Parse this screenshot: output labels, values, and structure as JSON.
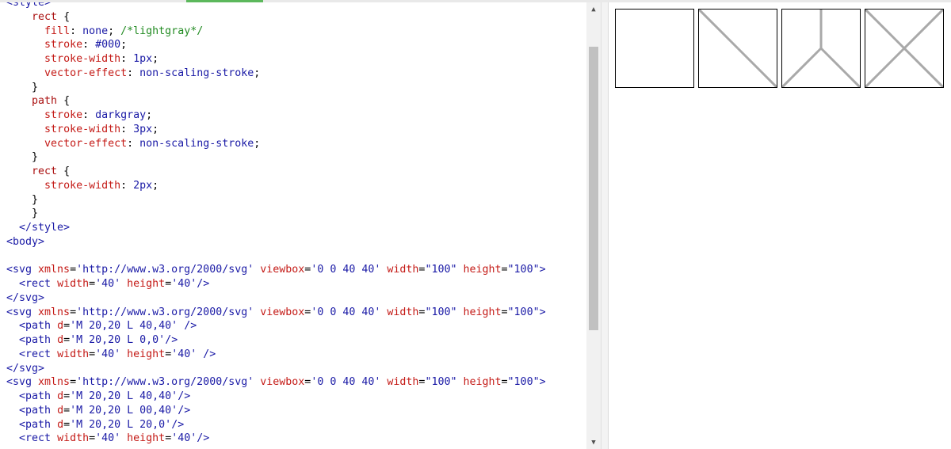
{
  "editor": {
    "lines": [
      {
        "indent": "",
        "tokens": [
          {
            "c": "c-tagb",
            "t": "<style>"
          }
        ]
      },
      {
        "indent": "    ",
        "tokens": [
          {
            "c": "c-sel",
            "t": "rect"
          },
          {
            "c": "c-punct",
            "t": " {"
          }
        ]
      },
      {
        "indent": "      ",
        "tokens": [
          {
            "c": "c-prop",
            "t": "fill"
          },
          {
            "c": "c-punct",
            "t": ": "
          },
          {
            "c": "c-val",
            "t": "none"
          },
          {
            "c": "c-punct",
            "t": "; "
          },
          {
            "c": "c-comment",
            "t": "/*lightgray*/"
          }
        ]
      },
      {
        "indent": "      ",
        "tokens": [
          {
            "c": "c-prop",
            "t": "stroke"
          },
          {
            "c": "c-punct",
            "t": ": "
          },
          {
            "c": "c-val",
            "t": "#000"
          },
          {
            "c": "c-punct",
            "t": ";"
          }
        ]
      },
      {
        "indent": "      ",
        "tokens": [
          {
            "c": "c-prop",
            "t": "stroke-width"
          },
          {
            "c": "c-punct",
            "t": ": "
          },
          {
            "c": "c-val",
            "t": "1px"
          },
          {
            "c": "c-punct",
            "t": ";"
          }
        ]
      },
      {
        "indent": "      ",
        "tokens": [
          {
            "c": "c-prop",
            "t": "vector-effect"
          },
          {
            "c": "c-punct",
            "t": ": "
          },
          {
            "c": "c-val",
            "t": "non-scaling-stroke"
          },
          {
            "c": "c-punct",
            "t": ";"
          }
        ]
      },
      {
        "indent": "    ",
        "tokens": [
          {
            "c": "c-punct",
            "t": "}"
          }
        ]
      },
      {
        "indent": "    ",
        "tokens": [
          {
            "c": "c-sel",
            "t": "path"
          },
          {
            "c": "c-punct",
            "t": " {"
          }
        ]
      },
      {
        "indent": "      ",
        "tokens": [
          {
            "c": "c-prop",
            "t": "stroke"
          },
          {
            "c": "c-punct",
            "t": ": "
          },
          {
            "c": "c-val",
            "t": "darkgray"
          },
          {
            "c": "c-punct",
            "t": ";"
          }
        ]
      },
      {
        "indent": "      ",
        "tokens": [
          {
            "c": "c-prop",
            "t": "stroke-width"
          },
          {
            "c": "c-punct",
            "t": ": "
          },
          {
            "c": "c-val",
            "t": "3px"
          },
          {
            "c": "c-punct",
            "t": ";"
          }
        ]
      },
      {
        "indent": "      ",
        "tokens": [
          {
            "c": "c-prop",
            "t": "vector-effect"
          },
          {
            "c": "c-punct",
            "t": ": "
          },
          {
            "c": "c-val",
            "t": "non-scaling-stroke"
          },
          {
            "c": "c-punct",
            "t": ";"
          }
        ]
      },
      {
        "indent": "    ",
        "tokens": [
          {
            "c": "c-punct",
            "t": "}"
          }
        ]
      },
      {
        "indent": "    ",
        "tokens": [
          {
            "c": "c-sel",
            "t": "rect"
          },
          {
            "c": "c-punct",
            "t": " {"
          }
        ]
      },
      {
        "indent": "      ",
        "tokens": [
          {
            "c": "c-prop",
            "t": "stroke-width"
          },
          {
            "c": "c-punct",
            "t": ": "
          },
          {
            "c": "c-val",
            "t": "2px"
          },
          {
            "c": "c-punct",
            "t": ";"
          }
        ]
      },
      {
        "indent": "    ",
        "tokens": [
          {
            "c": "c-punct",
            "t": "}"
          }
        ]
      },
      {
        "indent": "    ",
        "tokens": [
          {
            "c": "c-punct",
            "t": "}"
          }
        ]
      },
      {
        "indent": "  ",
        "tokens": [
          {
            "c": "c-tagb",
            "t": "</style>"
          }
        ]
      },
      {
        "indent": "",
        "tokens": [
          {
            "c": "c-tagb",
            "t": "<body>"
          }
        ]
      },
      {
        "indent": "",
        "tokens": []
      },
      {
        "indent": "",
        "tokens": [
          {
            "c": "c-tagb",
            "t": "<svg "
          },
          {
            "c": "c-prop",
            "t": "xmlns"
          },
          {
            "c": "c-punct",
            "t": "="
          },
          {
            "c": "c-val",
            "t": "'http://www.w3.org/2000/svg'"
          },
          {
            "c": "c-punct",
            "t": " "
          },
          {
            "c": "c-prop",
            "t": "viewbox"
          },
          {
            "c": "c-punct",
            "t": "="
          },
          {
            "c": "c-val",
            "t": "'0 0 40 40'"
          },
          {
            "c": "c-punct",
            "t": " "
          },
          {
            "c": "c-prop",
            "t": "width"
          },
          {
            "c": "c-punct",
            "t": "="
          },
          {
            "c": "c-val",
            "t": "\"100\""
          },
          {
            "c": "c-punct",
            "t": " "
          },
          {
            "c": "c-prop",
            "t": "height"
          },
          {
            "c": "c-punct",
            "t": "="
          },
          {
            "c": "c-val",
            "t": "\"100\""
          },
          {
            "c": "c-tagb",
            "t": ">"
          }
        ]
      },
      {
        "indent": "  ",
        "tokens": [
          {
            "c": "c-tagb",
            "t": "<rect "
          },
          {
            "c": "c-prop",
            "t": "width"
          },
          {
            "c": "c-punct",
            "t": "="
          },
          {
            "c": "c-val",
            "t": "'40'"
          },
          {
            "c": "c-punct",
            "t": " "
          },
          {
            "c": "c-prop",
            "t": "height"
          },
          {
            "c": "c-punct",
            "t": "="
          },
          {
            "c": "c-val",
            "t": "'40'"
          },
          {
            "c": "c-tagb",
            "t": "/>"
          }
        ]
      },
      {
        "indent": "",
        "tokens": [
          {
            "c": "c-tagb",
            "t": "</svg>"
          }
        ]
      },
      {
        "indent": "",
        "tokens": [
          {
            "c": "c-tagb",
            "t": "<svg "
          },
          {
            "c": "c-prop",
            "t": "xmlns"
          },
          {
            "c": "c-punct",
            "t": "="
          },
          {
            "c": "c-val",
            "t": "'http://www.w3.org/2000/svg'"
          },
          {
            "c": "c-punct",
            "t": " "
          },
          {
            "c": "c-prop",
            "t": "viewbox"
          },
          {
            "c": "c-punct",
            "t": "="
          },
          {
            "c": "c-val",
            "t": "'0 0 40 40'"
          },
          {
            "c": "c-punct",
            "t": " "
          },
          {
            "c": "c-prop",
            "t": "width"
          },
          {
            "c": "c-punct",
            "t": "="
          },
          {
            "c": "c-val",
            "t": "\"100\""
          },
          {
            "c": "c-punct",
            "t": " "
          },
          {
            "c": "c-prop",
            "t": "height"
          },
          {
            "c": "c-punct",
            "t": "="
          },
          {
            "c": "c-val",
            "t": "\"100\""
          },
          {
            "c": "c-tagb",
            "t": ">"
          }
        ]
      },
      {
        "indent": "  ",
        "tokens": [
          {
            "c": "c-tagb",
            "t": "<path "
          },
          {
            "c": "c-prop",
            "t": "d"
          },
          {
            "c": "c-punct",
            "t": "="
          },
          {
            "c": "c-val",
            "t": "'M 20,20 L 40,40'"
          },
          {
            "c": "c-punct",
            "t": " "
          },
          {
            "c": "c-tagb",
            "t": "/>"
          }
        ]
      },
      {
        "indent": "  ",
        "tokens": [
          {
            "c": "c-tagb",
            "t": "<path "
          },
          {
            "c": "c-prop",
            "t": "d"
          },
          {
            "c": "c-punct",
            "t": "="
          },
          {
            "c": "c-val",
            "t": "'M 20,20 L 0,0'"
          },
          {
            "c": "c-tagb",
            "t": "/>"
          }
        ]
      },
      {
        "indent": "  ",
        "tokens": [
          {
            "c": "c-tagb",
            "t": "<rect "
          },
          {
            "c": "c-prop",
            "t": "width"
          },
          {
            "c": "c-punct",
            "t": "="
          },
          {
            "c": "c-val",
            "t": "'40'"
          },
          {
            "c": "c-punct",
            "t": " "
          },
          {
            "c": "c-prop",
            "t": "height"
          },
          {
            "c": "c-punct",
            "t": "="
          },
          {
            "c": "c-val",
            "t": "'40'"
          },
          {
            "c": "c-punct",
            "t": " "
          },
          {
            "c": "c-tagb",
            "t": "/>"
          }
        ]
      },
      {
        "indent": "",
        "tokens": [
          {
            "c": "c-tagb",
            "t": "</svg>"
          }
        ]
      },
      {
        "indent": "",
        "tokens": [
          {
            "c": "c-tagb",
            "t": "<svg "
          },
          {
            "c": "c-prop",
            "t": "xmlns"
          },
          {
            "c": "c-punct",
            "t": "="
          },
          {
            "c": "c-val",
            "t": "'http://www.w3.org/2000/svg'"
          },
          {
            "c": "c-punct",
            "t": " "
          },
          {
            "c": "c-prop",
            "t": "viewbox"
          },
          {
            "c": "c-punct",
            "t": "="
          },
          {
            "c": "c-val",
            "t": "'0 0 40 40'"
          },
          {
            "c": "c-punct",
            "t": " "
          },
          {
            "c": "c-prop",
            "t": "width"
          },
          {
            "c": "c-punct",
            "t": "="
          },
          {
            "c": "c-val",
            "t": "\"100\""
          },
          {
            "c": "c-punct",
            "t": " "
          },
          {
            "c": "c-prop",
            "t": "height"
          },
          {
            "c": "c-punct",
            "t": "="
          },
          {
            "c": "c-val",
            "t": "\"100\""
          },
          {
            "c": "c-tagb",
            "t": ">"
          }
        ]
      },
      {
        "indent": "  ",
        "tokens": [
          {
            "c": "c-tagb",
            "t": "<path "
          },
          {
            "c": "c-prop",
            "t": "d"
          },
          {
            "c": "c-punct",
            "t": "="
          },
          {
            "c": "c-val",
            "t": "'M 20,20 L 40,40'"
          },
          {
            "c": "c-tagb",
            "t": "/>"
          }
        ]
      },
      {
        "indent": "  ",
        "tokens": [
          {
            "c": "c-tagb",
            "t": "<path "
          },
          {
            "c": "c-prop",
            "t": "d"
          },
          {
            "c": "c-punct",
            "t": "="
          },
          {
            "c": "c-val",
            "t": "'M 20,20 L 00,40'"
          },
          {
            "c": "c-tagb",
            "t": "/>"
          }
        ]
      },
      {
        "indent": "  ",
        "tokens": [
          {
            "c": "c-tagb",
            "t": "<path "
          },
          {
            "c": "c-prop",
            "t": "d"
          },
          {
            "c": "c-punct",
            "t": "="
          },
          {
            "c": "c-val",
            "t": "'M 20,20 L 20,0'"
          },
          {
            "c": "c-tagb",
            "t": "/>"
          }
        ]
      },
      {
        "indent": "  ",
        "tokens": [
          {
            "c": "c-tagb",
            "t": "<rect "
          },
          {
            "c": "c-prop",
            "t": "width"
          },
          {
            "c": "c-punct",
            "t": "="
          },
          {
            "c": "c-val",
            "t": "'40'"
          },
          {
            "c": "c-punct",
            "t": " "
          },
          {
            "c": "c-prop",
            "t": "height"
          },
          {
            "c": "c-punct",
            "t": "="
          },
          {
            "c": "c-val",
            "t": "'40'"
          },
          {
            "c": "c-tagb",
            "t": "/>"
          }
        ]
      }
    ]
  },
  "scrollbar": {
    "up_icon": "scroll-up-arrow-icon",
    "down_icon": "scroll-down-arrow-icon",
    "up_glyph": "▲",
    "down_glyph": "▼"
  },
  "preview": {
    "rect_stroke": "#000000",
    "path_stroke": "#a9a9a9",
    "svgs": [
      {
        "paths": []
      },
      {
        "paths": [
          [
            20,
            20,
            40,
            40
          ],
          [
            20,
            20,
            0,
            0
          ]
        ]
      },
      {
        "paths": [
          [
            20,
            20,
            40,
            40
          ],
          [
            20,
            20,
            0,
            40
          ],
          [
            20,
            20,
            20,
            0
          ]
        ]
      },
      {
        "paths": [
          [
            20,
            20,
            40,
            40
          ],
          [
            20,
            20,
            0,
            0
          ],
          [
            20,
            20,
            40,
            0
          ],
          [
            20,
            20,
            0,
            40
          ]
        ]
      }
    ]
  }
}
